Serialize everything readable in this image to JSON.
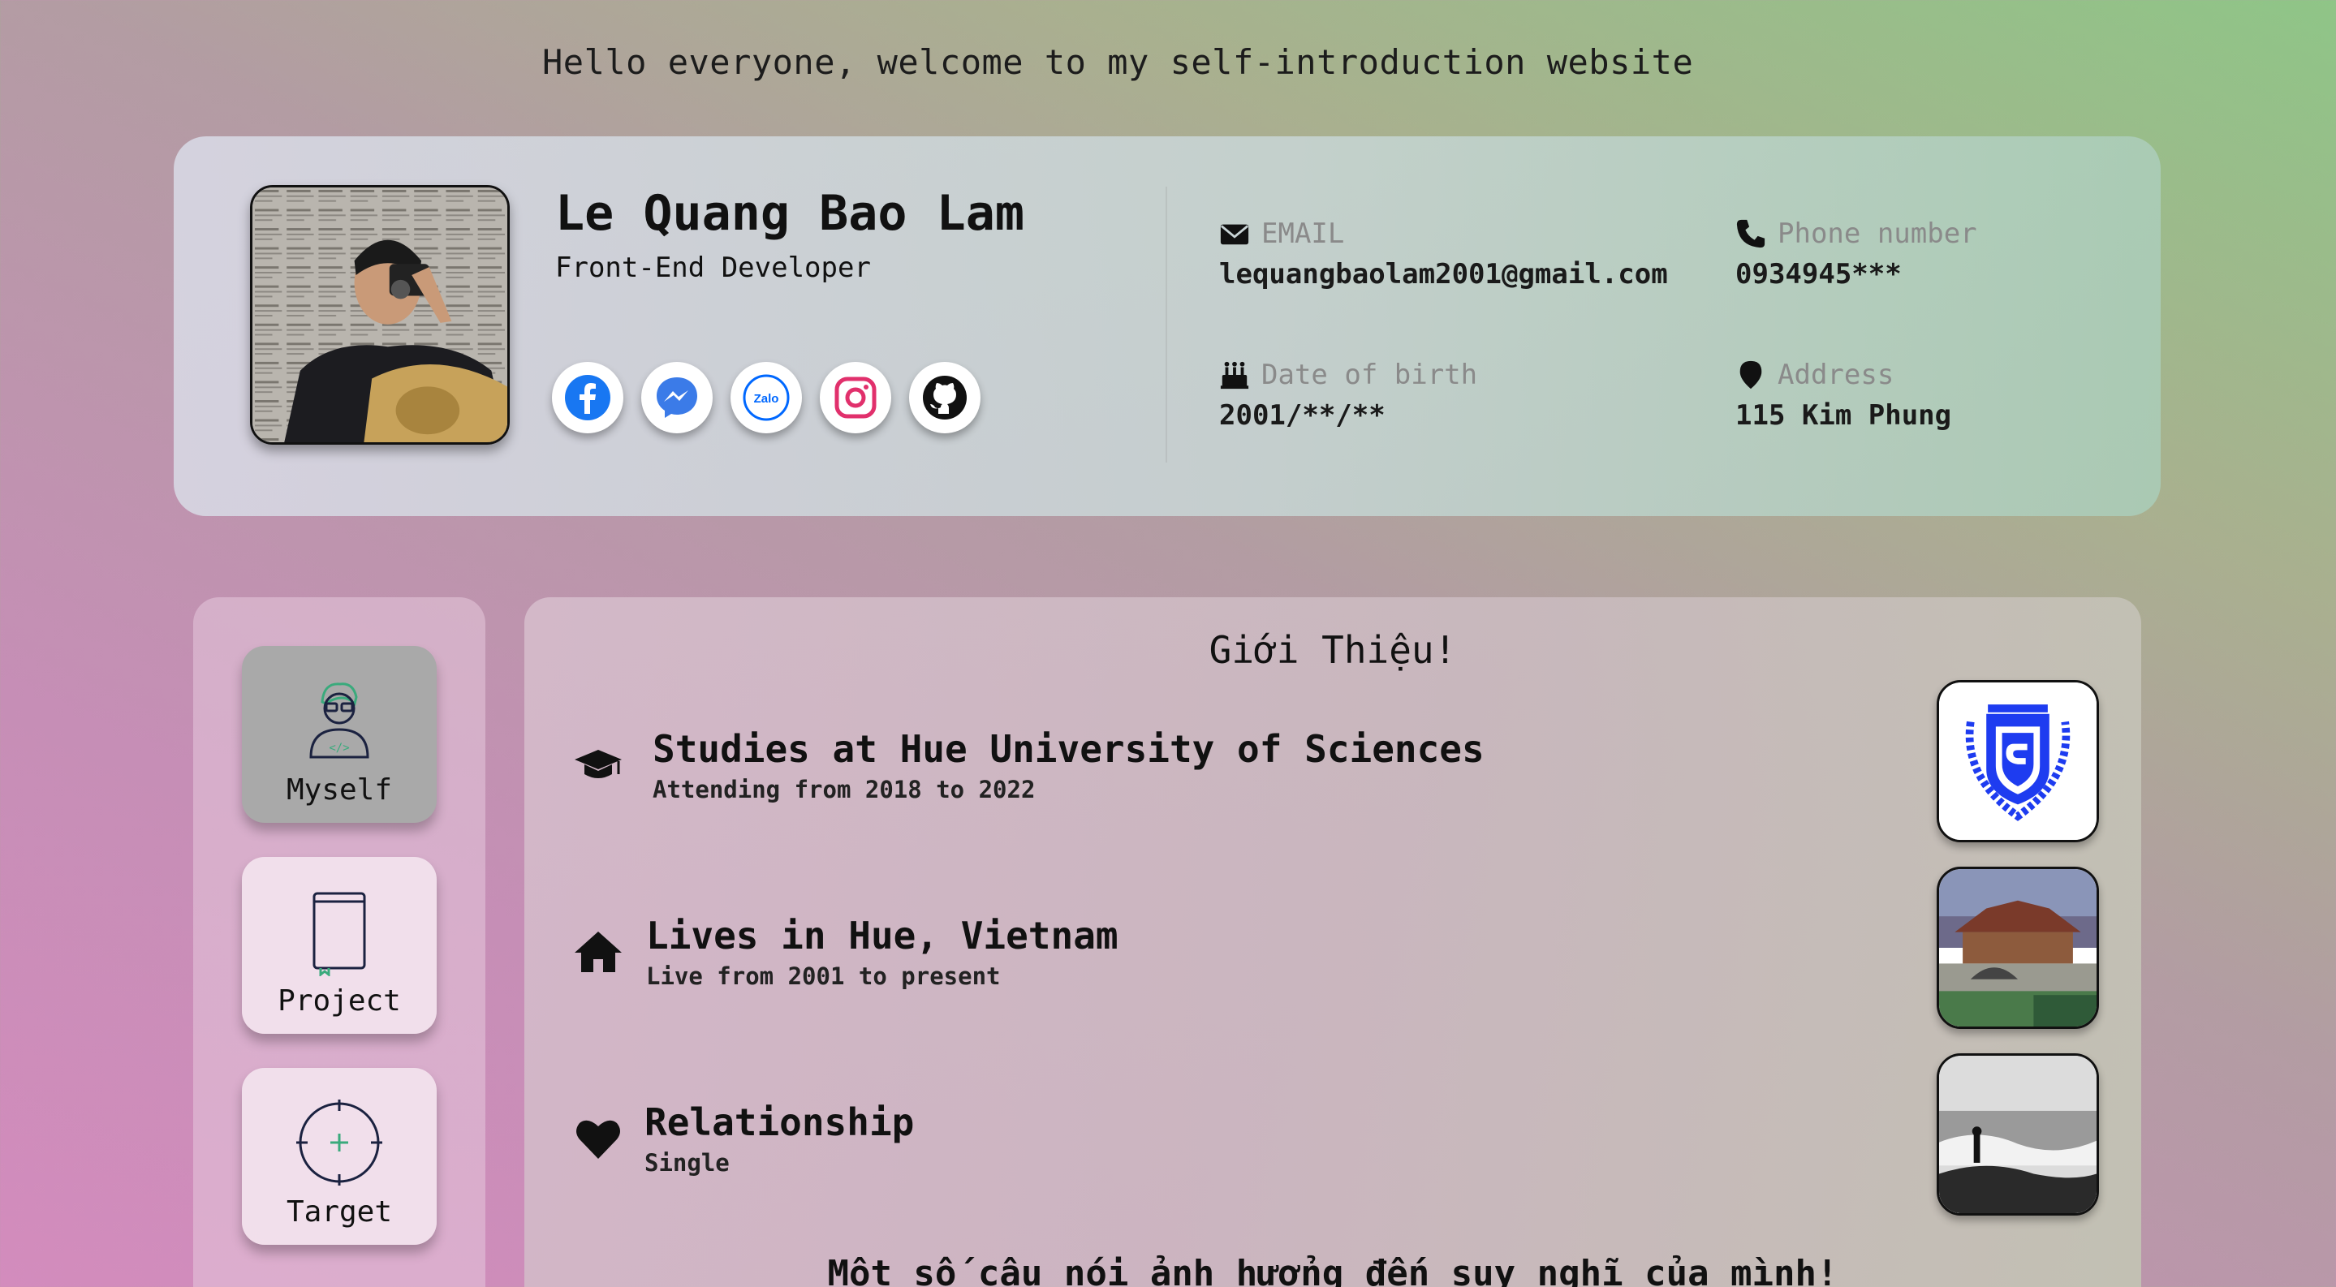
{
  "greeting": "Hello everyone, welcome to my self-introduction website",
  "profile": {
    "name": "Le Quang Bao Lam",
    "role": "Front-End Developer",
    "socials": [
      "facebook-icon",
      "messenger-icon",
      "zalo-icon",
      "instagram-icon",
      "github-icon"
    ],
    "zalo_text": "Zalo"
  },
  "contact": {
    "email_label": "EMAIL",
    "email_value": "lequangbaolam2001@gmail.com",
    "phone_label": "Phone number",
    "phone_value": "0934945***",
    "dob_label": "Date of birth",
    "dob_value": "2001/**/**",
    "address_label": "Address",
    "address_value": "115 Kim Phung"
  },
  "nav": {
    "items": [
      {
        "label": "Myself",
        "icon": "developer-icon",
        "active": true
      },
      {
        "label": "Project",
        "icon": "book-icon",
        "active": false
      },
      {
        "label": "Target",
        "icon": "crosshair-icon",
        "active": false
      }
    ]
  },
  "intro": {
    "title": "Giới Thiệu!",
    "items": [
      {
        "title": "Studies at Hue University of Sciences",
        "subtitle": "Attending from 2018 to 2022",
        "icon": "graduation-cap-icon"
      },
      {
        "title": "Lives in Hue, Vietnam",
        "subtitle": "Live from 2001 to present",
        "icon": "home-icon"
      },
      {
        "title": "Relationship",
        "subtitle": "Single",
        "icon": "heart-icon"
      }
    ],
    "quote_title": "Một số câu nói ảnh hưởng đến suy nghĩ của mình!"
  },
  "colors": {
    "facebook": "#1877f2",
    "messenger": "#3b7be8",
    "zalo": "#0068ff",
    "instagram": "#e1306c",
    "accent_green": "#3aaa7c",
    "university_blue": "#1e3cf0"
  }
}
